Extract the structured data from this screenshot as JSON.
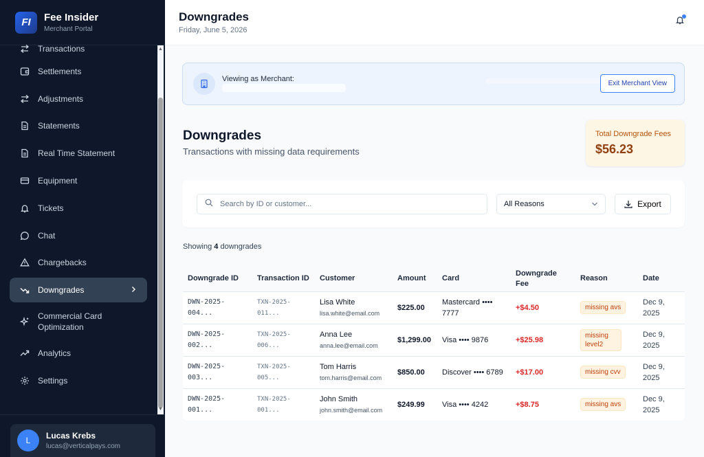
{
  "sidebar": {
    "brand_logo": "FI",
    "brand_title": "Fee Insider",
    "brand_subtitle": "Merchant Portal",
    "items": [
      {
        "label": "Transactions",
        "icon": "arrows-icon"
      },
      {
        "label": "Settlements",
        "icon": "wallet-icon"
      },
      {
        "label": "Adjustments",
        "icon": "arrows-icon"
      },
      {
        "label": "Statements",
        "icon": "document-icon"
      },
      {
        "label": "Real Time Statement",
        "icon": "document-icon"
      },
      {
        "label": "Equipment",
        "icon": "card-icon"
      },
      {
        "label": "Tickets",
        "icon": "bell-icon"
      },
      {
        "label": "Chat",
        "icon": "chat-icon"
      },
      {
        "label": "Chargebacks",
        "icon": "warning-icon"
      },
      {
        "label": "Downgrades",
        "icon": "trend-down-icon",
        "active": true
      },
      {
        "label": "Commercial Card Optimization",
        "icon": "sparkle-icon"
      },
      {
        "label": "Analytics",
        "icon": "trend-up-icon"
      },
      {
        "label": "Settings",
        "icon": "gear-icon"
      }
    ],
    "user": {
      "initial": "L",
      "name": "Lucas Krebs",
      "email": "lucas@verticalpays.com"
    }
  },
  "header": {
    "title": "Downgrades",
    "date": "Friday, June 5, 2026"
  },
  "banner": {
    "text": "Viewing as Merchant:",
    "exit_label": "Exit Merchant View"
  },
  "page": {
    "title": "Downgrades",
    "subtitle": "Transactions with missing data requirements"
  },
  "fees": {
    "label": "Total Downgrade Fees",
    "value": "$56.23"
  },
  "filters": {
    "search_placeholder": "Search by ID or customer...",
    "reason_selected": "All Reasons",
    "export_label": "Export"
  },
  "showing": {
    "prefix": "Showing",
    "count": "4",
    "suffix": "downgrades"
  },
  "table": {
    "headers": [
      "Downgrade ID",
      "Transaction ID",
      "Customer",
      "Amount",
      "Card",
      "Downgrade Fee",
      "Reason",
      "Date"
    ],
    "rows": [
      {
        "id": "DWN-2025-004...",
        "txn": "TXN-2025-011...",
        "name": "Lisa White",
        "email": "lisa.white@email.com",
        "amount": "$225.00",
        "card": "Mastercard •••• 7777",
        "fee": "+$4.50",
        "reason": "missing avs",
        "date": "Dec 9, 2025"
      },
      {
        "id": "DWN-2025-002...",
        "txn": "TXN-2025-006...",
        "name": "Anna Lee",
        "email": "anna.lee@email.com",
        "amount": "$1,299.00",
        "card": "Visa •••• 9876",
        "fee": "+$25.98",
        "reason": "missing level2",
        "date": "Dec 9, 2025"
      },
      {
        "id": "DWN-2025-003...",
        "txn": "TXN-2025-005...",
        "name": "Tom Harris",
        "email": "tom.harris@email.com",
        "amount": "$850.00",
        "card": "Discover •••• 6789",
        "fee": "+$17.00",
        "reason": "missing cvv",
        "date": "Dec 9, 2025"
      },
      {
        "id": "DWN-2025-001...",
        "txn": "TXN-2025-001...",
        "name": "John Smith",
        "email": "john.smith@email.com",
        "amount": "$249.99",
        "card": "Visa •••• 4242",
        "fee": "+$8.75",
        "reason": "missing avs",
        "date": "Dec 9, 2025"
      }
    ]
  }
}
